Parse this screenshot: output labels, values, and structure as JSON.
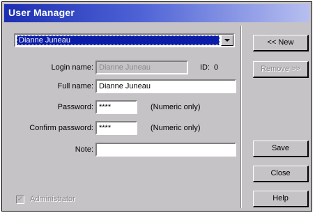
{
  "window": {
    "title": "User Manager"
  },
  "user_select": {
    "selected": "Dianne Juneau"
  },
  "form": {
    "login_label": "Login name:",
    "login_value": "Dianne Juneau",
    "id_label": "ID:",
    "id_value": "0",
    "fullname_label": "Full name:",
    "fullname_value": "Dianne Juneau",
    "password_label": "Password:",
    "password_value": "****",
    "password_hint": "(Numeric only)",
    "confirm_label": "Confirm password:",
    "confirm_value": "****",
    "confirm_hint": "(Numeric only)",
    "note_label": "Note:",
    "note_value": ""
  },
  "buttons": {
    "new": "<< New",
    "remove": "Remove >>",
    "save": "Save",
    "close": "Close",
    "help": "Help"
  },
  "administrator": {
    "label": "Administrator",
    "checked": true
  }
}
